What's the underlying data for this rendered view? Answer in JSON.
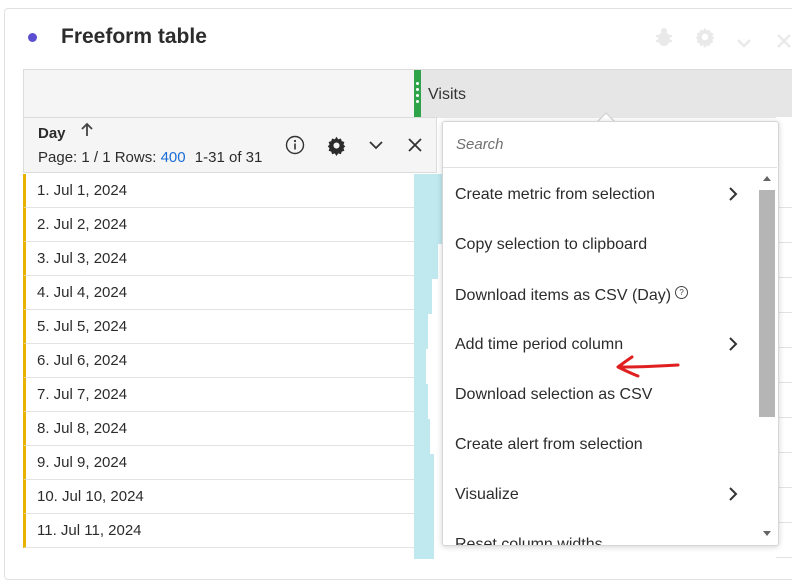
{
  "panel": {
    "title": "Freeform table",
    "accent_color": "#5b4ed1"
  },
  "header_icons": [
    "bug-icon",
    "gear-icon",
    "chevron-down-icon",
    "close-icon"
  ],
  "metric_column": {
    "label": "Visits",
    "grip_color": "#2fa34a",
    "bar_color": "#bfe9ee"
  },
  "dimension": {
    "label": "Day",
    "sort_icon": "arrow-up-icon",
    "page_prefix": "Page: 1 / 1 Rows:",
    "rows_per_page": "400",
    "range": "1-31 of 31",
    "icons": [
      "info-icon",
      "gear-icon",
      "chevron-down-icon",
      "close-icon"
    ]
  },
  "rows": [
    "1.  Jul 1, 2024",
    "2.  Jul 2, 2024",
    "3.  Jul 3, 2024",
    "4.  Jul 4, 2024",
    "5.  Jul 5, 2024",
    "6.  Jul 6, 2024",
    "7.  Jul 7, 2024",
    "8.  Jul 8, 2024",
    "9.  Jul 9, 2024",
    "10.  Jul 10, 2024",
    "11.  Jul 11, 2024"
  ],
  "menu": {
    "search_placeholder": "Search",
    "items": [
      {
        "label": "Create metric from selection",
        "has_submenu": true
      },
      {
        "label": "Copy selection to clipboard",
        "has_submenu": false
      },
      {
        "label": "Download items as CSV (Day)",
        "has_submenu": false,
        "help_icon": true
      },
      {
        "label": "Add time period column",
        "has_submenu": true
      },
      {
        "label": "Download selection as CSV",
        "has_submenu": false
      },
      {
        "label": "Create alert from selection",
        "has_submenu": false
      },
      {
        "label": "Visualize",
        "has_submenu": true
      },
      {
        "label": "Reset column widths",
        "has_submenu": false
      }
    ]
  },
  "annotation_color": "#e02020"
}
